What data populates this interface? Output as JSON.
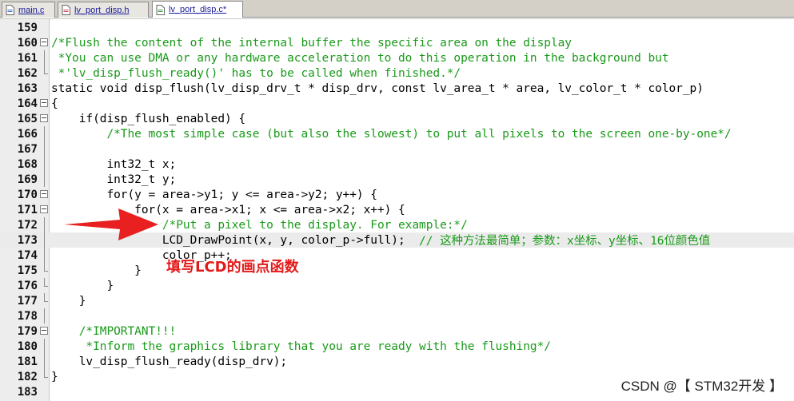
{
  "tabs": [
    {
      "label": "main.c",
      "active": false
    },
    {
      "label": "lv_port_disp.h",
      "active": false
    },
    {
      "label": "lv_port_disp.c*",
      "active": true
    }
  ],
  "lines": [
    {
      "num": "159",
      "fold": "",
      "text": "",
      "comment": false
    },
    {
      "num": "160",
      "fold": "box",
      "text": "/*Flush the content of the internal buffer the specific area on the display",
      "comment": true
    },
    {
      "num": "161",
      "fold": "line",
      "text": " *You can use DMA or any hardware acceleration to do this operation in the background but",
      "comment": true
    },
    {
      "num": "162",
      "fold": "end",
      "text": " *'lv_disp_flush_ready()' has to be called when finished.*/",
      "comment": true
    },
    {
      "num": "163",
      "fold": "",
      "text": "static void disp_flush(lv_disp_drv_t * disp_drv, const lv_area_t * area, lv_color_t * color_p)",
      "comment": false
    },
    {
      "num": "164",
      "fold": "box",
      "text": "{",
      "comment": false
    },
    {
      "num": "165",
      "fold": "box",
      "text": "    if(disp_flush_enabled) {",
      "comment": false
    },
    {
      "num": "166",
      "fold": "line",
      "text": "        /*The most simple case (but also the slowest) to put all pixels to the screen one-by-one*/",
      "comment": true
    },
    {
      "num": "167",
      "fold": "line",
      "text": "",
      "comment": false
    },
    {
      "num": "168",
      "fold": "line",
      "text": "        int32_t x;",
      "comment": false
    },
    {
      "num": "169",
      "fold": "line",
      "text": "        int32_t y;",
      "comment": false
    },
    {
      "num": "170",
      "fold": "box",
      "text": "        for(y = area->y1; y <= area->y2; y++) {",
      "comment": false
    },
    {
      "num": "171",
      "fold": "box",
      "text": "            for(x = area->x1; x <= area->x2; x++) {",
      "comment": false
    },
    {
      "num": "172",
      "fold": "line",
      "text": "                /*Put a pixel to the display. For example:*/",
      "comment": true
    },
    {
      "num": "173",
      "fold": "line",
      "text": "                LCD_DrawPoint(x, y, color_p->full);",
      "comment": false,
      "trailing_comment": "  // 这种方法最简单；参数：x坐标、y坐标、16位颜色值",
      "highlight": true
    },
    {
      "num": "174",
      "fold": "line",
      "text": "                color_p++;",
      "comment": false
    },
    {
      "num": "175",
      "fold": "end",
      "text": "            }",
      "comment": false
    },
    {
      "num": "176",
      "fold": "end",
      "text": "        }",
      "comment": false
    },
    {
      "num": "177",
      "fold": "end",
      "text": "    }",
      "comment": false
    },
    {
      "num": "178",
      "fold": "line",
      "text": "",
      "comment": false
    },
    {
      "num": "179",
      "fold": "box",
      "text": "    /*IMPORTANT!!!",
      "comment": true
    },
    {
      "num": "180",
      "fold": "line",
      "text": "     *Inform the graphics library that you are ready with the flushing*/",
      "comment": true
    },
    {
      "num": "181",
      "fold": "line",
      "text": "    lv_disp_flush_ready(disp_drv);",
      "comment": false
    },
    {
      "num": "182",
      "fold": "end",
      "text": "}",
      "comment": false
    },
    {
      "num": "183",
      "fold": "",
      "text": "",
      "comment": false
    }
  ],
  "annotation": "填写LCD的画点函数",
  "watermark": "CSDN @【 STM32开发 】",
  "colors": {
    "comment": "#1a9a1a",
    "annotation": "#e31b1b",
    "arrow": "#e82020"
  }
}
